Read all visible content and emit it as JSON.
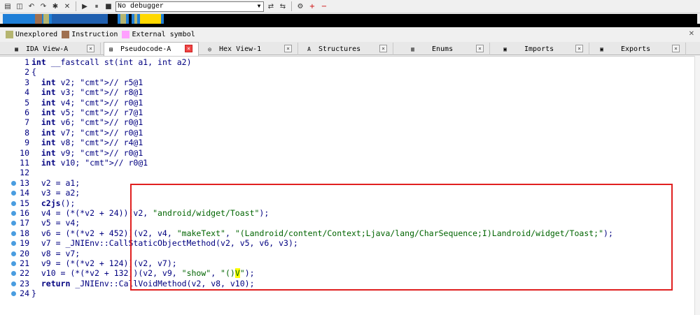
{
  "toolbar": {
    "debugger_select": "No debugger",
    "icons": [
      "open-icon",
      "save-icon",
      "back-icon",
      "forward-icon",
      "breakpoint-icon",
      "close-icon",
      "play-icon",
      "pause-icon",
      "stop-icon",
      "attach-icon",
      "detach-icon",
      "settings-icon",
      "add-icon",
      "remove-icon"
    ]
  },
  "legend": {
    "items": [
      {
        "label": "Unexplored",
        "color": "#b5b570"
      },
      {
        "label": "Instruction",
        "color": "#a07050"
      },
      {
        "label": "External symbol",
        "color": "#ffa0ff"
      }
    ]
  },
  "tabs": [
    {
      "label": "IDA View-A",
      "active": false,
      "icon": "graph-icon"
    },
    {
      "label": "Pseudocode-A",
      "active": true,
      "icon": "pseudocode-icon"
    },
    {
      "label": "Hex View-1",
      "active": false,
      "icon": "hex-icon"
    },
    {
      "label": "Structures",
      "active": false,
      "icon": "structures-icon"
    },
    {
      "label": "Enums",
      "active": false,
      "icon": "enums-icon"
    },
    {
      "label": "Imports",
      "active": false,
      "icon": "imports-icon"
    },
    {
      "label": "Exports",
      "active": false,
      "icon": "exports-icon"
    }
  ],
  "code": {
    "lines": [
      {
        "n": "1",
        "text": "int __fastcall st(int a1, int a2)"
      },
      {
        "n": "2",
        "text": "{"
      },
      {
        "n": "3",
        "text": "  int v2; // r5@1"
      },
      {
        "n": "4",
        "text": "  int v3; // r8@1"
      },
      {
        "n": "5",
        "text": "  int v4; // r0@1"
      },
      {
        "n": "6",
        "text": "  int v5; // r7@1"
      },
      {
        "n": "7",
        "text": "  int v6; // r0@1"
      },
      {
        "n": "8",
        "text": "  int v7; // r0@1"
      },
      {
        "n": "9",
        "text": "  int v8; // r4@1"
      },
      {
        "n": "10",
        "text": "  int v9; // r0@1"
      },
      {
        "n": "11",
        "text": "  int v10; // r0@1"
      },
      {
        "n": "12",
        "text": ""
      },
      {
        "n": "13",
        "text": "  v2 = a1;"
      },
      {
        "n": "14",
        "text": "  v3 = a2;"
      },
      {
        "n": "15",
        "text": "  c2js();"
      },
      {
        "n": "16",
        "text": "  v4 = (*(*v2 + 24))(v2, \"android/widget/Toast\");"
      },
      {
        "n": "17",
        "text": "  v5 = v4;"
      },
      {
        "n": "18",
        "text": "  v6 = (*(*v2 + 452))(v2, v4, \"makeText\", \"(Landroid/content/Context;Ljava/lang/CharSequence;I)Landroid/widget/Toast;\");"
      },
      {
        "n": "19",
        "text": "  v7 = _JNIEnv::CallStaticObjectMethod(v2, v5, v6, v3);"
      },
      {
        "n": "20",
        "text": "  v8 = v7;"
      },
      {
        "n": "21",
        "text": "  v9 = (*(*v2 + 124))(v2, v7);"
      },
      {
        "n": "22",
        "text": "  v10 = (*(*v2 + 132))(v2, v9, \"show\", \"()V\");"
      },
      {
        "n": "23",
        "text": "  return _JNIEnv::CallVoidMethod(v2, v8, v10);"
      },
      {
        "n": "24",
        "text": "}"
      }
    ]
  },
  "colors": {
    "keyword": "#000080",
    "comment": "#2f8ab8",
    "string": "#006400",
    "highlight": "#ffff00",
    "annotation_box": "#e02020",
    "breakpoint_dot": "#4a9de0"
  }
}
